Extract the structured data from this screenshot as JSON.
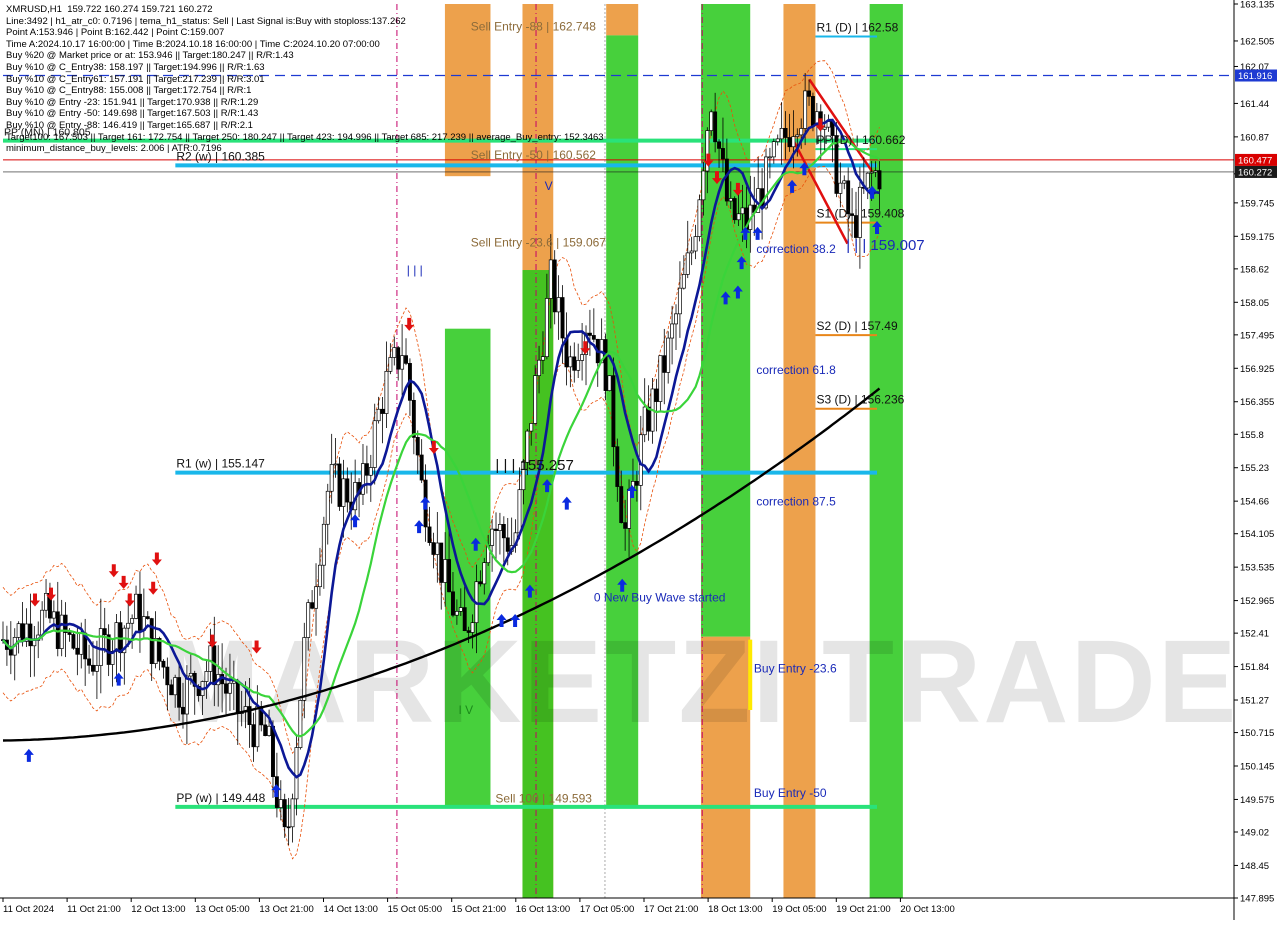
{
  "chart_data": {
    "type": "candlestick",
    "symbol": "XMRUSD,H1",
    "header_quote": "159.722 160.274 159.721 160.272",
    "info_lines": [
      "Line:3492 | h1_atr_c0: 0.7196 | tema_h1_status: Sell | Last Signal is:Buy with stoploss:137.262",
      "Point A:153.946 | Point B:162.442 | Point C:159.007",
      "Time A:2024.10.17 16:00:00 | Time B:2024.10.18 16:00:00 | Time C:2024.10.20 07:00:00",
      "Buy %20 @ Market price or at: 153.946 || Target:180.247 || R/R:1.43",
      "Buy %10 @ C_Entry38: 158.197 || Target:194.996 || R/R:1.63",
      "Buy %10 @ C_Entry61: 157.191 || Target:217.239 || R/R:3.01",
      "Buy %10 @ C_Entry88: 155.008 || Target:172.754 || R/R:1",
      "Buy %10 @ Entry -23: 151.941 || Target:170.938 || R/R:1.29",
      "Buy %10 @ Entry -50: 149.698 || Target:167.503 || R/R:1.43",
      "Buy %10 @ Entry -88: 146.419 || Target:165.687 || R/R:2.1",
      "Target100: 167.503 || Target 161: 172.754 || Target 250: 180.247 || Target 423: 194.996 || Target 685: 217.239 || average_Buy_entry: 152.3463",
      "minimum_distance_buy_levels: 2.006 | ATR:0.7196"
    ],
    "y_axis": {
      "min": 147.895,
      "max": 163.135,
      "ticks": [
        163.135,
        162.505,
        162.07,
        161.44,
        160.87,
        160.24,
        159.745,
        159.175,
        158.62,
        158.05,
        157.495,
        156.925,
        156.355,
        155.8,
        155.23,
        154.66,
        154.105,
        153.535,
        152.965,
        152.41,
        151.84,
        151.27,
        150.715,
        150.145,
        149.575,
        149.02,
        148.45,
        147.895
      ]
    },
    "x_axis": {
      "labels": [
        "11 Oct 2024",
        "11 Oct 21:00",
        "12 Oct 13:00",
        "13 Oct 05:00",
        "13 Oct 21:00",
        "14 Oct 13:00",
        "15 Oct 05:00",
        "15 Oct 21:00",
        "16 Oct 13:00",
        "17 Oct 05:00",
        "17 Oct 21:00",
        "18 Oct 13:00",
        "19 Oct 05:00",
        "19 Oct 21:00",
        "20 Oct 13:00"
      ]
    },
    "price_badges": [
      {
        "value": "161.916",
        "price": 161.916,
        "color": "#1e3ad2"
      },
      {
        "value": "160.477",
        "price": 160.477,
        "color": "#d90000"
      },
      {
        "value": "160.272",
        "price": 160.272,
        "color": "#1a1a1a"
      }
    ],
    "horizontal_levels": [
      {
        "label": "R1 (w) | 155.147",
        "price": 155.147,
        "color": "#19b7ea",
        "x_from": 0.14,
        "x_to": 0.71
      },
      {
        "label": "PP (w) | 149.448",
        "price": 149.448,
        "color": "#29e27a",
        "x_from": 0.14,
        "x_to": 0.71
      },
      {
        "label": "R1 (D) | 162.58",
        "price": 162.58,
        "color": "#19b7ea",
        "x_from": 0.66,
        "x_to": 0.71
      },
      {
        "label": "PP (D) | 160.662",
        "price": 160.662,
        "color": "#29e27a",
        "x_from": 0.66,
        "x_to": 0.71
      },
      {
        "label": "S1 (D) | 159.408",
        "price": 159.408,
        "color": "#e8861a",
        "x_from": 0.66,
        "x_to": 0.71
      },
      {
        "label": "S2 (D) | 157.49",
        "price": 157.49,
        "color": "#e8861a",
        "x_from": 0.66,
        "x_to": 0.71
      },
      {
        "label": "S3 (D) | 156.236",
        "price": 156.236,
        "color": "#e8861a",
        "x_from": 0.66,
        "x_to": 0.71
      },
      {
        "label": "R2 (w) | 160.385",
        "price": 160.385,
        "color": "#19b7ea",
        "x_from": 0.14,
        "x_to": 0.71
      },
      {
        "label": "PP (MN) | 160.805",
        "price": 160.805,
        "color": "#29e27a",
        "x_from": 0.0,
        "x_to": 0.71
      }
    ],
    "text_annotations": [
      {
        "text": "Sell Entry -88 | 162.748",
        "price": 162.748,
        "xf": 0.38,
        "color": "#8c6b3a"
      },
      {
        "text": "Sell Entry -50 | 160.562",
        "price": 160.562,
        "xf": 0.38,
        "color": "#8c6b3a"
      },
      {
        "text": "Sell Entry -23.6 | 159.067",
        "price": 159.067,
        "xf": 0.38,
        "color": "#8c6b3a"
      },
      {
        "text": "Sell 100 | 149.593",
        "price": 149.593,
        "xf": 0.4,
        "color": "#8c6b3a"
      },
      {
        "text": "| | | 155.257",
        "price": 155.257,
        "xf": 0.4,
        "color": "#111111"
      },
      {
        "text": "| | | 159.007",
        "price": 159.007,
        "xf": 0.685,
        "color": "#1a2ab8"
      },
      {
        "text": "correction 38.2",
        "price": 158.958,
        "xf": 0.612,
        "color": "#1a2ab8"
      },
      {
        "text": "correction 61.8",
        "price": 156.893,
        "xf": 0.612,
        "color": "#1a2ab8"
      },
      {
        "text": "correction 87.5",
        "price": 154.658,
        "xf": 0.612,
        "color": "#1a2ab8"
      },
      {
        "text": "0 New Buy Wave started",
        "price": 153.014,
        "xf": 0.48,
        "color": "#1a2ab8"
      },
      {
        "text": "Buy Entry -23.6",
        "price": 151.807,
        "xf": 0.61,
        "color": "#1a2ab8"
      },
      {
        "text": "Buy Entry -50",
        "price": 149.688,
        "xf": 0.61,
        "color": "#1a2ab8"
      },
      {
        "text": "| | |",
        "price": 158.601,
        "xf": 0.328,
        "color": "#1a2ab8"
      },
      {
        "text": "I V",
        "price": 151.097,
        "xf": 0.37,
        "color": "#1a8a1a"
      },
      {
        "text": "V",
        "price": 160.034,
        "xf": 0.44,
        "color": "#1a2ab8"
      }
    ],
    "zones": [
      {
        "xf": 0.359,
        "w": 0.037,
        "color": "#e8861a",
        "from": 160.2,
        "to": 163.135
      },
      {
        "xf": 0.359,
        "w": 0.037,
        "color": "#27c81a",
        "from": 149.45,
        "to": 157.6
      },
      {
        "xf": 0.422,
        "w": 0.025,
        "color": "#e8861a",
        "from": 147.895,
        "to": 163.135
      },
      {
        "xf": 0.422,
        "w": 0.025,
        "color": "#27c81a",
        "from": 147.895,
        "to": 158.6
      },
      {
        "xf": 0.49,
        "w": 0.026,
        "color": "#e8861a",
        "from": 162.6,
        "to": 163.135
      },
      {
        "xf": 0.49,
        "w": 0.026,
        "color": "#27c81a",
        "from": 149.45,
        "to": 162.6
      },
      {
        "xf": 0.567,
        "w": 0.04,
        "color": "#27c81a",
        "from": 152.35,
        "to": 163.135
      },
      {
        "xf": 0.567,
        "w": 0.04,
        "color": "#e8861a",
        "from": 147.895,
        "to": 152.35
      },
      {
        "xf": 0.634,
        "w": 0.026,
        "color": "#e8861a",
        "from": 147.895,
        "to": 163.135
      },
      {
        "xf": 0.704,
        "w": 0.027,
        "color": "#27c81a",
        "from": 147.895,
        "to": 163.135
      }
    ]
  },
  "watermark": "MARKETZI TRADE"
}
